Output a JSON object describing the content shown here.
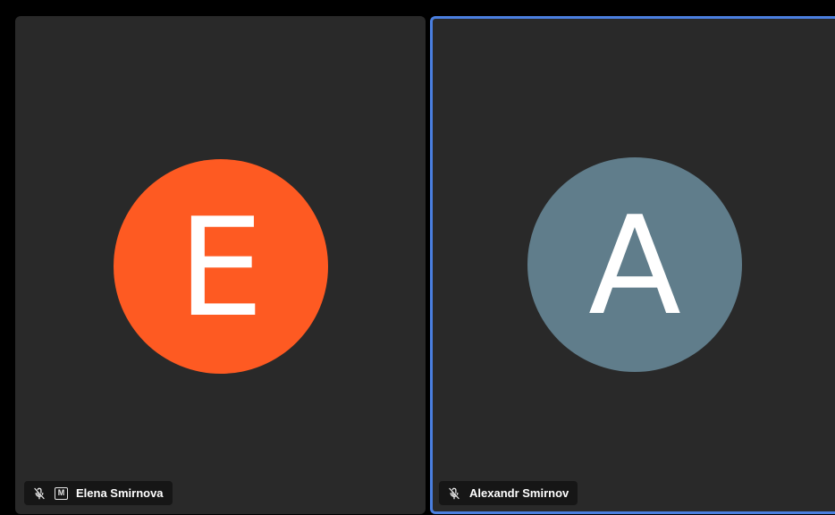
{
  "participants": [
    {
      "name": "Elena Smirnova",
      "initial": "E",
      "avatar_color": "#fe5a22",
      "muted_icon": "muted-mic-icon",
      "moderator_label": "M",
      "active_speaker": false
    },
    {
      "name": "Alexandr Smirnov",
      "initial": "A",
      "avatar_color": "#607d8b",
      "muted_icon": "muted-mic-icon",
      "active_speaker": true,
      "active_border_color": "#4a7fe0"
    }
  ]
}
